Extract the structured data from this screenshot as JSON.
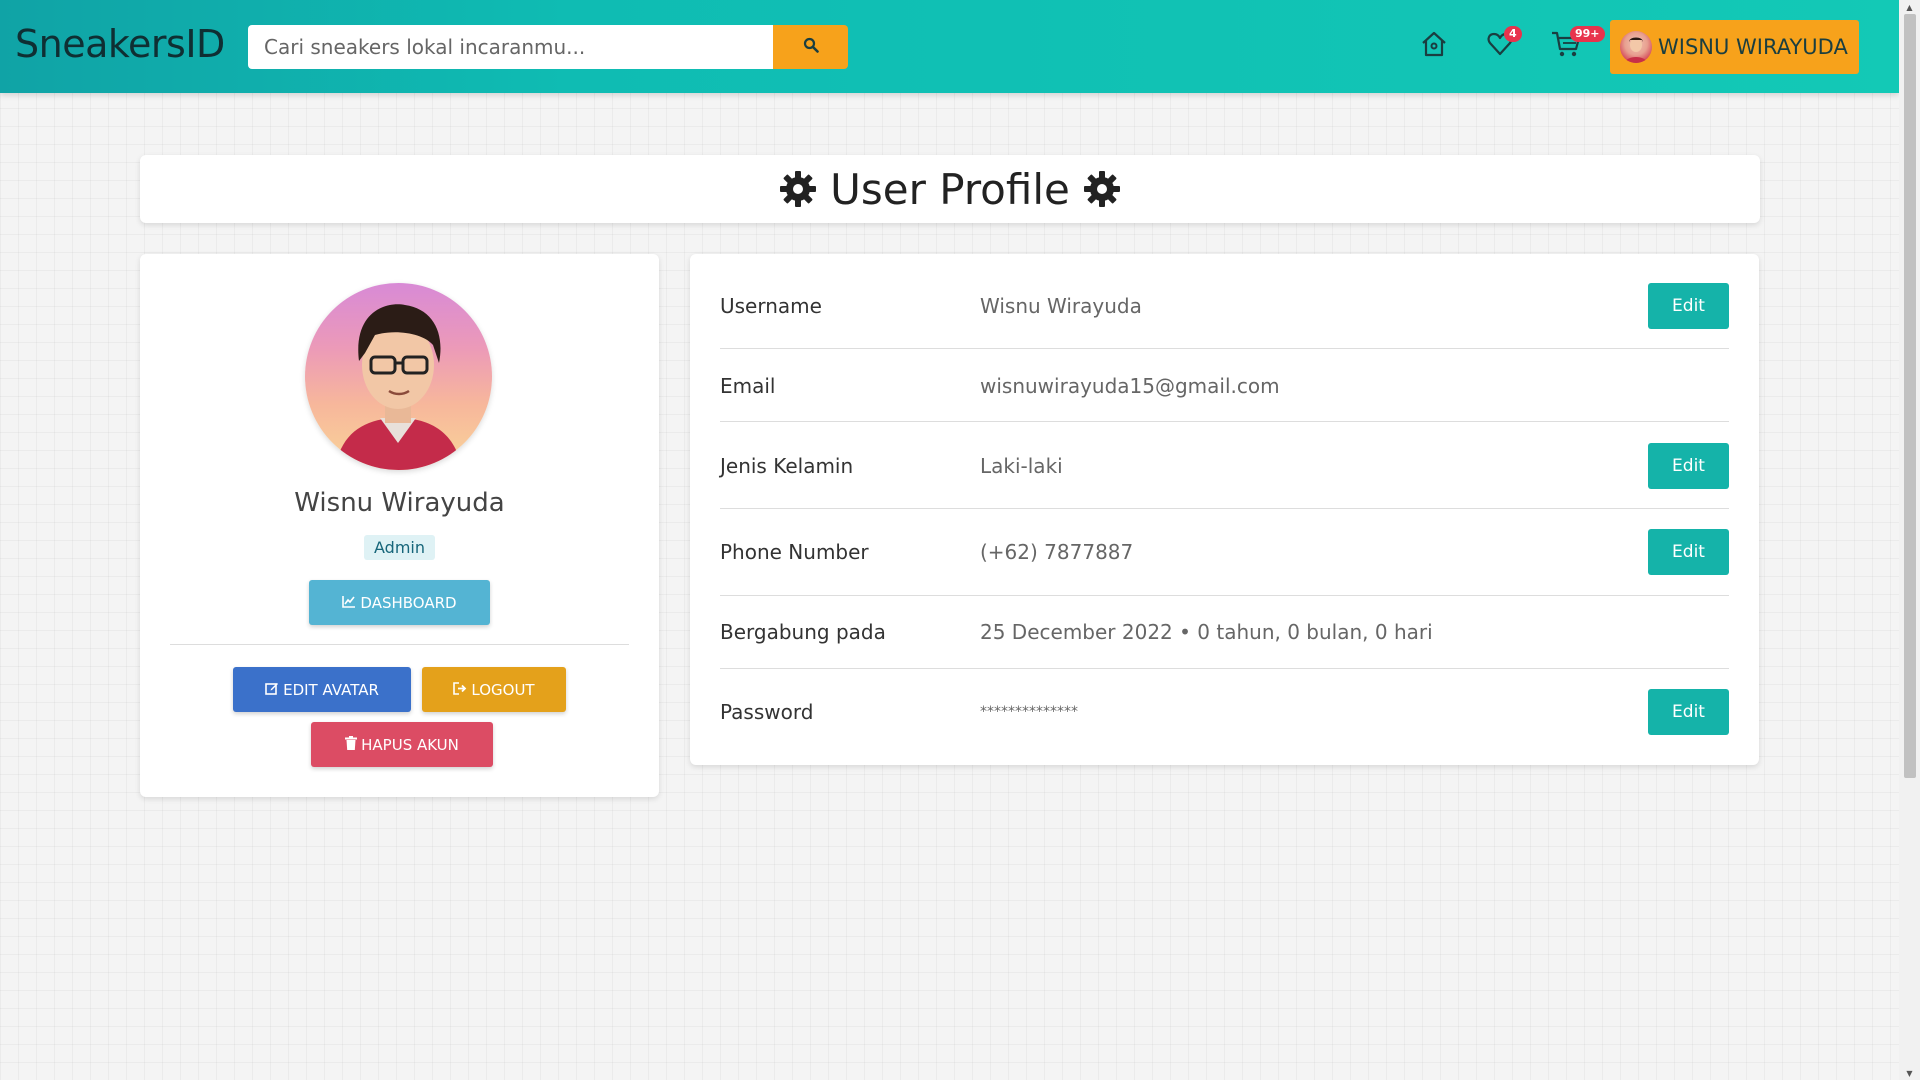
{
  "navbar": {
    "brand": "SneakersID",
    "search_placeholder": "Cari sneakers lokal incaranmu...",
    "wishlist_count": "4",
    "cart_count": "99+",
    "user_name": "WISNU WIRAYUDA",
    "icons": [
      "search-icon",
      "home-icon",
      "heart-icon",
      "cart-icon"
    ]
  },
  "page": {
    "title": "User Profile"
  },
  "profile": {
    "name": "Wisnu Wirayuda",
    "role": "Admin",
    "dashboard_label": "DASHBOARD",
    "edit_avatar_label": "EDIT AVATAR",
    "logout_label": "LOGOUT",
    "delete_label": "HAPUS AKUN"
  },
  "details": [
    {
      "label": "Username",
      "value": "Wisnu Wirayuda",
      "editable": true
    },
    {
      "label": "Email",
      "value": "wisnuwirayuda15@gmail.com",
      "editable": false
    },
    {
      "label": "Jenis Kelamin",
      "value": "Laki-laki",
      "editable": true
    },
    {
      "label": "Phone Number",
      "value": "(+62) 7877887",
      "editable": true
    },
    {
      "label": "Bergabung pada",
      "value": "25 December 2022 • 0 tahun, 0 bulan, 0 hari",
      "editable": false
    },
    {
      "label": "Password",
      "value": "**************",
      "editable": true
    }
  ],
  "edit_label": "Edit",
  "colors": {
    "navbar": "#13c9b6",
    "accent_orange": "#f7a21b",
    "teal_button": "#15b3a9",
    "dashboard": "#54b4d3",
    "edit_avatar": "#3b71ca",
    "logout": "#e4a11b",
    "delete": "#dc4c64"
  }
}
